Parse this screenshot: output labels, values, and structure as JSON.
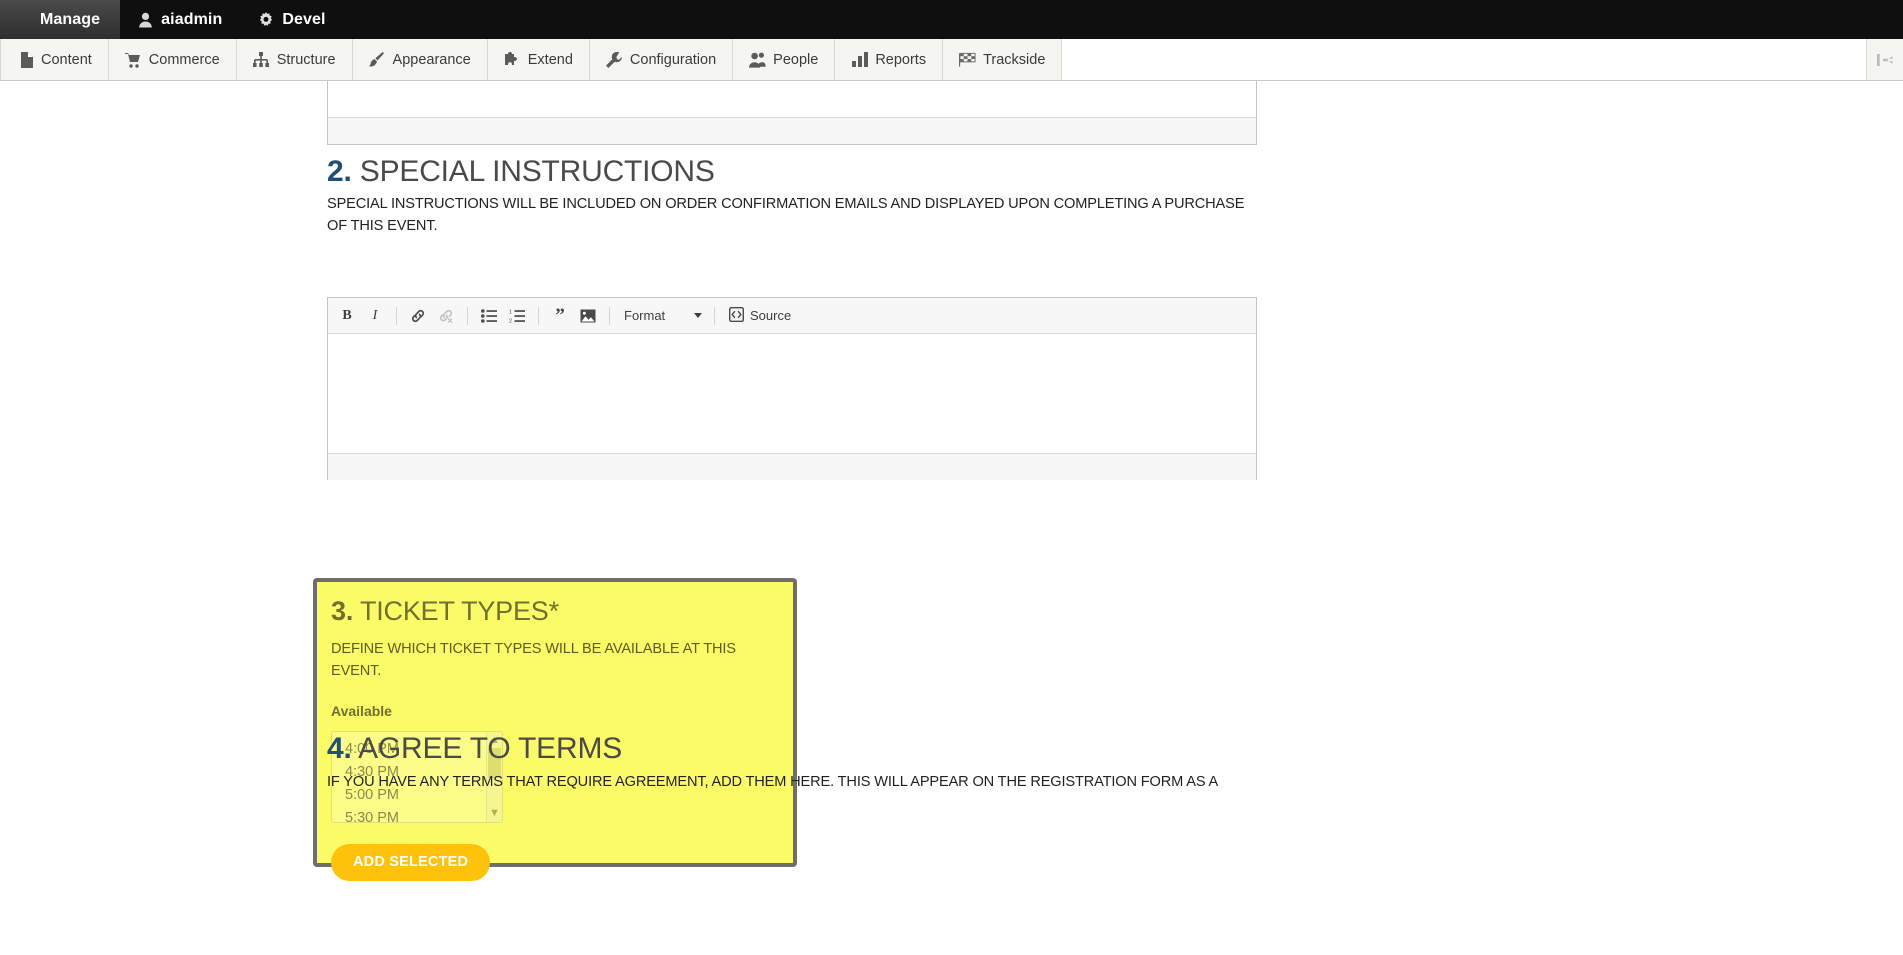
{
  "admin_toolbar": {
    "items": [
      {
        "label": "Manage",
        "icon": "hamburger-icon",
        "name": "manage"
      },
      {
        "label": "aiadmin",
        "icon": "user-icon",
        "name": "aiadmin"
      },
      {
        "label": "Devel",
        "icon": "gear-icon",
        "name": "devel"
      }
    ]
  },
  "menu_bar": {
    "items": [
      {
        "label": "Content",
        "icon": "document-icon",
        "name": "content"
      },
      {
        "label": "Commerce",
        "icon": "cart-icon",
        "name": "commerce"
      },
      {
        "label": "Structure",
        "icon": "structure-icon",
        "name": "structure"
      },
      {
        "label": "Appearance",
        "icon": "paintbrush-icon",
        "name": "appearance"
      },
      {
        "label": "Extend",
        "icon": "puzzle-icon",
        "name": "extend"
      },
      {
        "label": "Configuration",
        "icon": "wrench-icon",
        "name": "configuration"
      },
      {
        "label": "People",
        "icon": "people-icon",
        "name": "people"
      },
      {
        "label": "Reports",
        "icon": "bar-chart-icon",
        "name": "reports"
      },
      {
        "label": "Trackside",
        "icon": "checkered-flag-icon",
        "name": "trackside"
      }
    ],
    "toggle_icon": "collapse-sidebar-icon"
  },
  "editors": {
    "top_partial": {
      "status_text": ""
    },
    "special_instructions": {
      "toolbar": {
        "bold": "B",
        "italic": "I",
        "link": "link-icon",
        "unlink": "unlink-icon",
        "bulleted_list": "bulleted-list-icon",
        "numbered_list": "numbered-list-icon",
        "blockquote": "blockquote-icon",
        "image": "image-icon",
        "format_label": "Format",
        "source_label": "Source"
      },
      "content": "",
      "status_text": ""
    }
  },
  "sections": [
    {
      "number": "2.",
      "title": "SPECIAL INSTRUCTIONS",
      "description": "SPECIAL INSTRUCTIONS WILL BE INCLUDED ON ORDER CONFIRMATION EMAILS AND DISPLAYED UPON COMPLETING A PURCHASE OF THIS EVENT."
    },
    {
      "number": "3.",
      "title": "TICKET TYPES*",
      "description": "DEFINE WHICH TICKET TYPES WILL BE AVAILABLE AT THIS EVENT."
    },
    {
      "number": "4.",
      "title": "AGREE TO TERMS",
      "description": "IF YOU HAVE ANY TERMS THAT REQUIRE AGREEMENT, ADD THEM HERE. THIS WILL APPEAR ON THE REGISTRATION FORM AS A"
    }
  ],
  "ticket_types": {
    "heading_number": "3.",
    "heading_title": "TICKET TYPES*",
    "description": "DEFINE WHICH TICKET TYPES WILL BE AVAILABLE AT THIS EVENT.",
    "available_label": "Available",
    "options": [
      "4:00 PM",
      "4:30 PM",
      "5:00 PM",
      "5:30 PM"
    ],
    "add_button_label": "ADD SELECTED"
  },
  "colors": {
    "highlight_background": "#fbfb68",
    "highlight_border": "#6e6e6e",
    "accent_button": "#ffc20a",
    "section_number": "#1f4e79",
    "toolbar_black": "#0f0f0f"
  }
}
